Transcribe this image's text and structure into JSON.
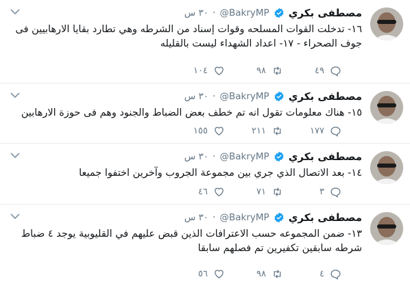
{
  "tweets": [
    {
      "name": "مصطفى بكري",
      "handle": "@BakryMP",
      "time": "٣٠ س",
      "text": "١٦- تدخلت القوات المسلحه وقوات إسناد من الشرطه وهي تطارد بقايا الارهابيين فى جوف الصحراء - ١٧- اعداد الشهداء ليست بالقليله",
      "reply_count": "٤٩",
      "retweet_count": "٩٨",
      "like_count": "١٠٤"
    },
    {
      "name": "مصطفى بكري",
      "handle": "@BakryMP",
      "time": "٣٠ س",
      "text": "١٥- هناك معلومات تقول انه تم خطف بعض الضباط والجنود وهم فى حوزة الارهابين",
      "reply_count": "١٧٧",
      "retweet_count": "٢١١",
      "like_count": "١٥٥"
    },
    {
      "name": "مصطفى بكري",
      "handle": "@BakryMP",
      "time": "٣٠ س",
      "text": "١٤- بعد الاتصال الذي جري بين مجموعة الجروب وآخرين اختفوا جميعا",
      "reply_count": "٣",
      "retweet_count": "٧١",
      "like_count": "٤٦"
    },
    {
      "name": "مصطفى بكري",
      "handle": "@BakryMP",
      "time": "٣٠ س",
      "text": "١٣- ضمن المجموعه حسب الاعترافات الذين قبض عليهم في القليوبية يوجد ٤ ضباط شرطه سابقين تكفيرين تم فصلهم سابقا",
      "reply_count": "٤",
      "retweet_count": "٩٨",
      "like_count": "٥٦"
    }
  ],
  "colors": {
    "verified": "#1da1f2",
    "muted": "#657786",
    "border": "#e6ecf0"
  },
  "icons": [
    "verified-badge-icon",
    "caret-down-icon",
    "reply-icon",
    "retweet-icon",
    "like-icon"
  ]
}
